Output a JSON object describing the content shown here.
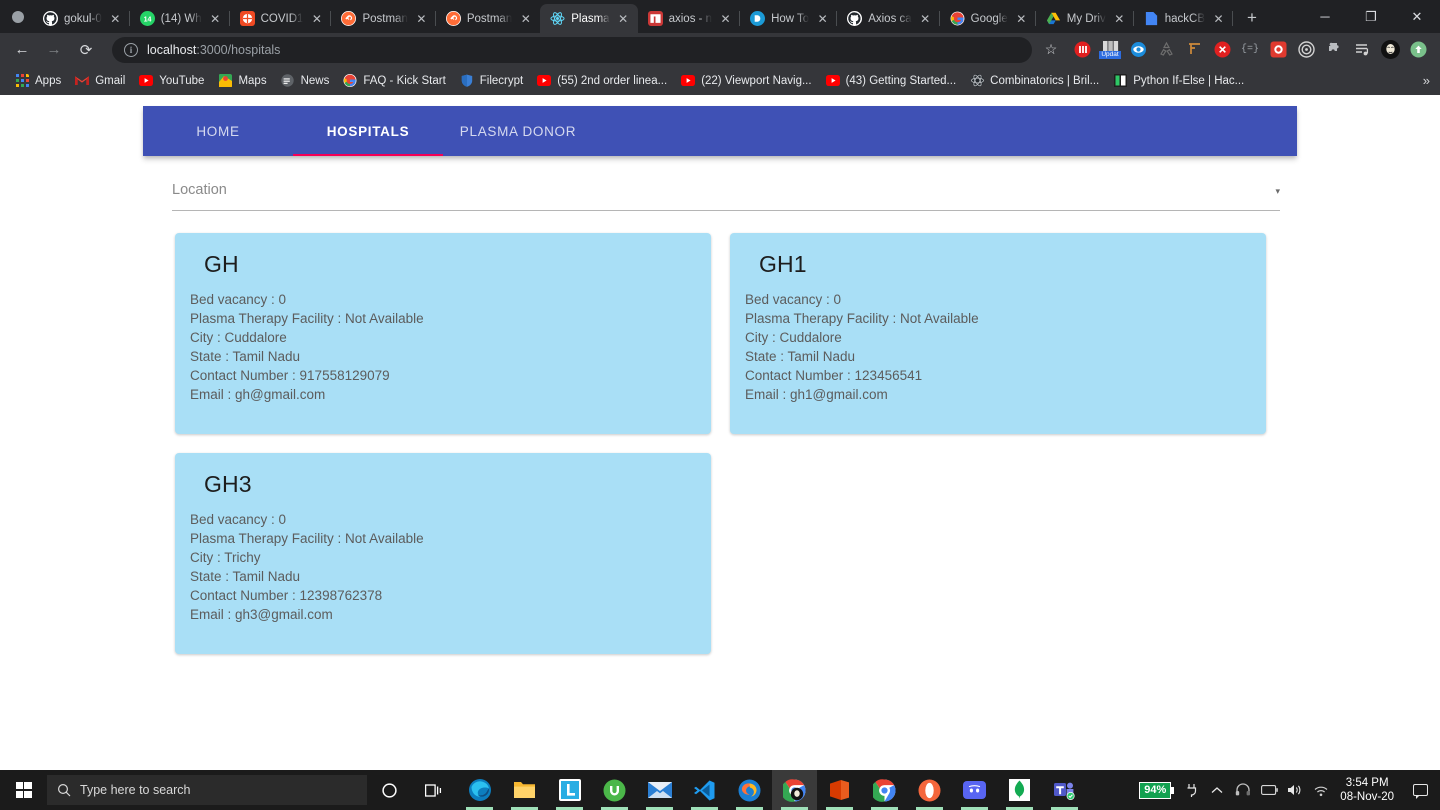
{
  "browser": {
    "tabs": [
      {
        "title": "gokul-0",
        "icon": "github-icon",
        "active": false
      },
      {
        "title": "(14) Wh",
        "icon": "whatsapp-icon",
        "active": false
      },
      {
        "title": "COVID1",
        "icon": "covid-icon",
        "active": false
      },
      {
        "title": "Postman",
        "icon": "postman-icon",
        "active": false
      },
      {
        "title": "Postman",
        "icon": "postman-icon",
        "active": false
      },
      {
        "title": "Plasma",
        "icon": "react-icon",
        "active": true
      },
      {
        "title": "axios - n",
        "icon": "npm-icon",
        "active": false
      },
      {
        "title": "How To",
        "icon": "howto-icon",
        "active": false
      },
      {
        "title": "Axios ca",
        "icon": "github-icon",
        "active": false
      },
      {
        "title": "Google",
        "icon": "google-icon",
        "active": false
      },
      {
        "title": "My Driv",
        "icon": "drive-icon",
        "active": false
      },
      {
        "title": "hackCB",
        "icon": "hackcb-icon",
        "active": false
      }
    ],
    "new_tab_label": "+",
    "window_controls": {
      "minimize": "─",
      "maximize": "❐",
      "close": "✕"
    },
    "nav": {
      "back": "←",
      "forward": "→",
      "reload": "⟳"
    },
    "omnibox": {
      "info_glyph": "i",
      "host": "localhost",
      "path": ":3000/hospitals"
    },
    "star_glyph": "☆",
    "extensions": [
      "adblock-icon",
      "update-badge-icon",
      "eye-icon",
      "recycle-icon",
      "ruler-icon",
      "stop-icon",
      "code-icon",
      "bug-icon",
      "target-icon",
      "puzzle-icon",
      "playlist-icon",
      "anon-avatar-icon",
      "upload-icon"
    ],
    "update_badge_label": "Updat",
    "bookmarks": [
      {
        "label": "Apps",
        "icon": "apps-grid-icon"
      },
      {
        "label": "Gmail",
        "icon": "gmail-icon"
      },
      {
        "label": "YouTube",
        "icon": "youtube-icon"
      },
      {
        "label": "Maps",
        "icon": "maps-icon"
      },
      {
        "label": "News",
        "icon": "news-icon"
      },
      {
        "label": "FAQ - Kick Start",
        "icon": "google-icon"
      },
      {
        "label": "Filecrypt",
        "icon": "shield-icon"
      },
      {
        "label": "(55) 2nd order linea...",
        "icon": "youtube-icon"
      },
      {
        "label": "(22) Viewport Navig...",
        "icon": "youtube-icon"
      },
      {
        "label": "(43) Getting Started...",
        "icon": "youtube-icon"
      },
      {
        "label": "Combinatorics | Bril...",
        "icon": "brilliant-icon"
      },
      {
        "label": "Python If-Else | Hac...",
        "icon": "hackerrank-icon"
      }
    ],
    "bookmarks_overflow_glyph": "»"
  },
  "app": {
    "nav_tabs": [
      {
        "label": "HOME",
        "selected": false
      },
      {
        "label": "HOSPITALS",
        "selected": true
      },
      {
        "label": "PLASMA DONOR",
        "selected": false
      }
    ],
    "accent_color": "#3f51b5",
    "underline_color": "#f50057",
    "card_color": "#a9dff6",
    "location_select": {
      "label": "Location",
      "value": "",
      "placeholder": "Location",
      "arrow_glyph": "▾"
    },
    "field_labels": {
      "bed_vacancy": "Bed vacancy",
      "plasma_facility": "Plasma Therapy Facility",
      "city": "City",
      "state": "State",
      "contact": "Contact Number",
      "email": "Email"
    },
    "hospitals": [
      {
        "name": "GH",
        "lines": [
          "Bed vacancy : 0",
          "Plasma Therapy Facility : Not Available",
          "City : Cuddalore",
          "State : Tamil Nadu",
          "Contact Number : 917558129079",
          "Email : gh@gmail.com"
        ]
      },
      {
        "name": "GH1",
        "lines": [
          "Bed vacancy : 0",
          "Plasma Therapy Facility : Not Available",
          "City : Cuddalore",
          "State : Tamil Nadu",
          "Contact Number : 123456541",
          "Email : gh1@gmail.com"
        ]
      },
      {
        "name": "GH3",
        "lines": [
          "Bed vacancy : 0",
          "Plasma Therapy Facility : Not Available",
          "City : Trichy",
          "State : Tamil Nadu",
          "Contact Number : 12398762378",
          "Email : gh3@gmail.com"
        ]
      }
    ]
  },
  "taskbar": {
    "search_placeholder": "Type here to search",
    "cortana_glyph": "○",
    "taskview_glyph": "⎕",
    "apps": [
      "edge-icon",
      "file-explorer-icon",
      "lightshot-icon",
      "utorrent-icon",
      "mail-icon",
      "vscode-icon",
      "firefox-icon",
      "chrome-active-icon",
      "office-icon",
      "chrome-icon",
      "opera-icon",
      "discord-icon",
      "mongodb-icon",
      "teams-icon"
    ],
    "battery_percent": "94%",
    "tray_icons": [
      "plug-icon",
      "chevron-up-icon",
      "headset-icon",
      "battery-icon",
      "volume-icon",
      "wifi-icon"
    ],
    "time": "3:54 PM",
    "date": "08-Nov-20",
    "notification_glyph": "☐"
  }
}
